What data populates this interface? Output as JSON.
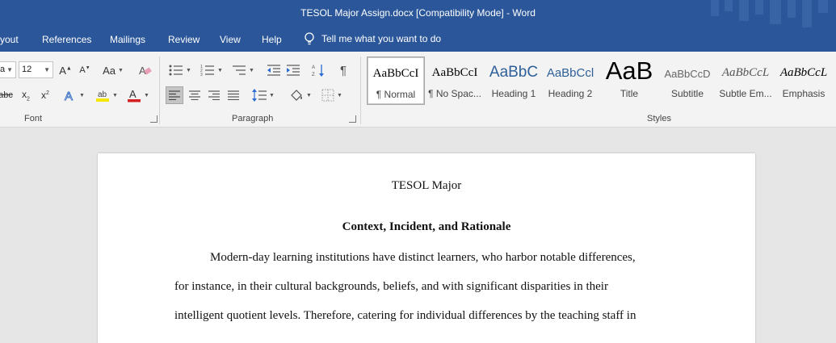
{
  "window": {
    "title": "TESOL Major Assign.docx [Compatibility Mode]  -  Word"
  },
  "menu": {
    "tabs": [
      "yout",
      "References",
      "Mailings",
      "Review",
      "View",
      "Help"
    ],
    "tell_me": "Tell me what you want to do"
  },
  "ribbon": {
    "font": {
      "group_label": "Font",
      "font_name": "a",
      "font_size": "12"
    },
    "paragraph": {
      "group_label": "Paragraph"
    },
    "styles": {
      "group_label": "Styles",
      "items": [
        {
          "sample": "AaBbCcI",
          "name": "¶ Normal"
        },
        {
          "sample": "AaBbCcI",
          "name": "¶ No Spac..."
        },
        {
          "sample": "AaBbC",
          "name": "Heading 1"
        },
        {
          "sample": "AaBbCcl",
          "name": "Heading 2"
        },
        {
          "sample": "AaB",
          "name": "Title"
        },
        {
          "sample": "AaBbCcD",
          "name": "Subtitle"
        },
        {
          "sample": "AaBbCcL",
          "name": "Subtle Em..."
        },
        {
          "sample": "AaBbCcL",
          "name": "Emphasis"
        }
      ]
    }
  },
  "document": {
    "title": "TESOL Major",
    "heading": "Context, Incident, and Rationale",
    "lines": [
      "Modern-day learning institutions have distinct learners, who harbor notable differences,",
      "for instance, in their cultural backgrounds, beliefs, and with significant disparities in their",
      "intelligent quotient levels. Therefore, catering for individual differences by the teaching staff in"
    ]
  },
  "colors": {
    "accent": "#2b579a",
    "ribbon": "#f3f3f3",
    "canvas": "#e6e6e6"
  }
}
